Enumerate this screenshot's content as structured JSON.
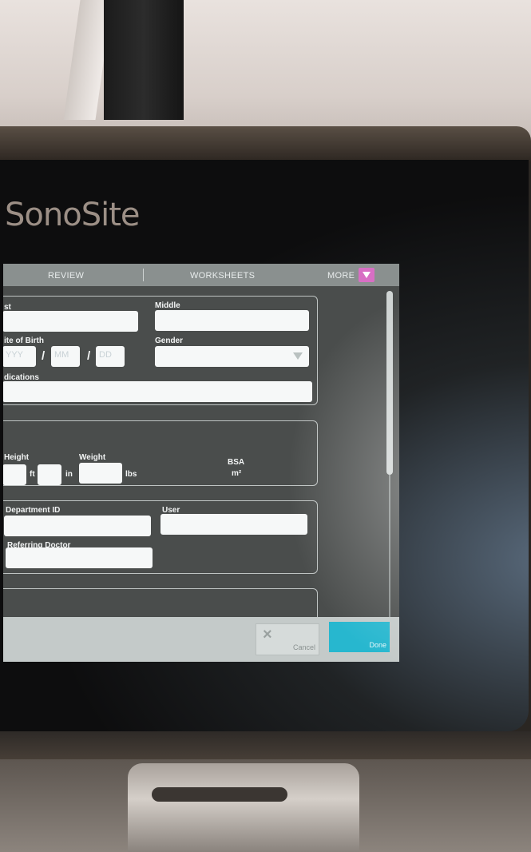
{
  "device": {
    "brand": "SonoSite"
  },
  "tabs": {
    "review": "REVIEW",
    "worksheets": "WORKSHEETS",
    "more": "MORE"
  },
  "patient": {
    "last_label": "st",
    "middle_label": "Middle",
    "dob_label": "ite of Birth",
    "dob_year_placeholder": "YYY",
    "dob_month_placeholder": "MM",
    "dob_day_placeholder": "DD",
    "dob_separator": "/",
    "gender_label": "Gender",
    "indications_label": "dications"
  },
  "measurements": {
    "height_label": "Height",
    "height_unit_ft": "ft",
    "height_unit_in": "in",
    "weight_label": "Weight",
    "weight_unit": "lbs",
    "bsa_label": "BSA",
    "bsa_unit": "m²"
  },
  "exam_info": {
    "department_label": "Department ID",
    "user_label": "User",
    "referring_label": "Referring Doctor"
  },
  "actions": {
    "cancel": "Cancel",
    "cancel_icon": "×",
    "done": "Done"
  },
  "colors": {
    "accent_done": "#27b7cf",
    "more_badge": "#d86fc4"
  }
}
